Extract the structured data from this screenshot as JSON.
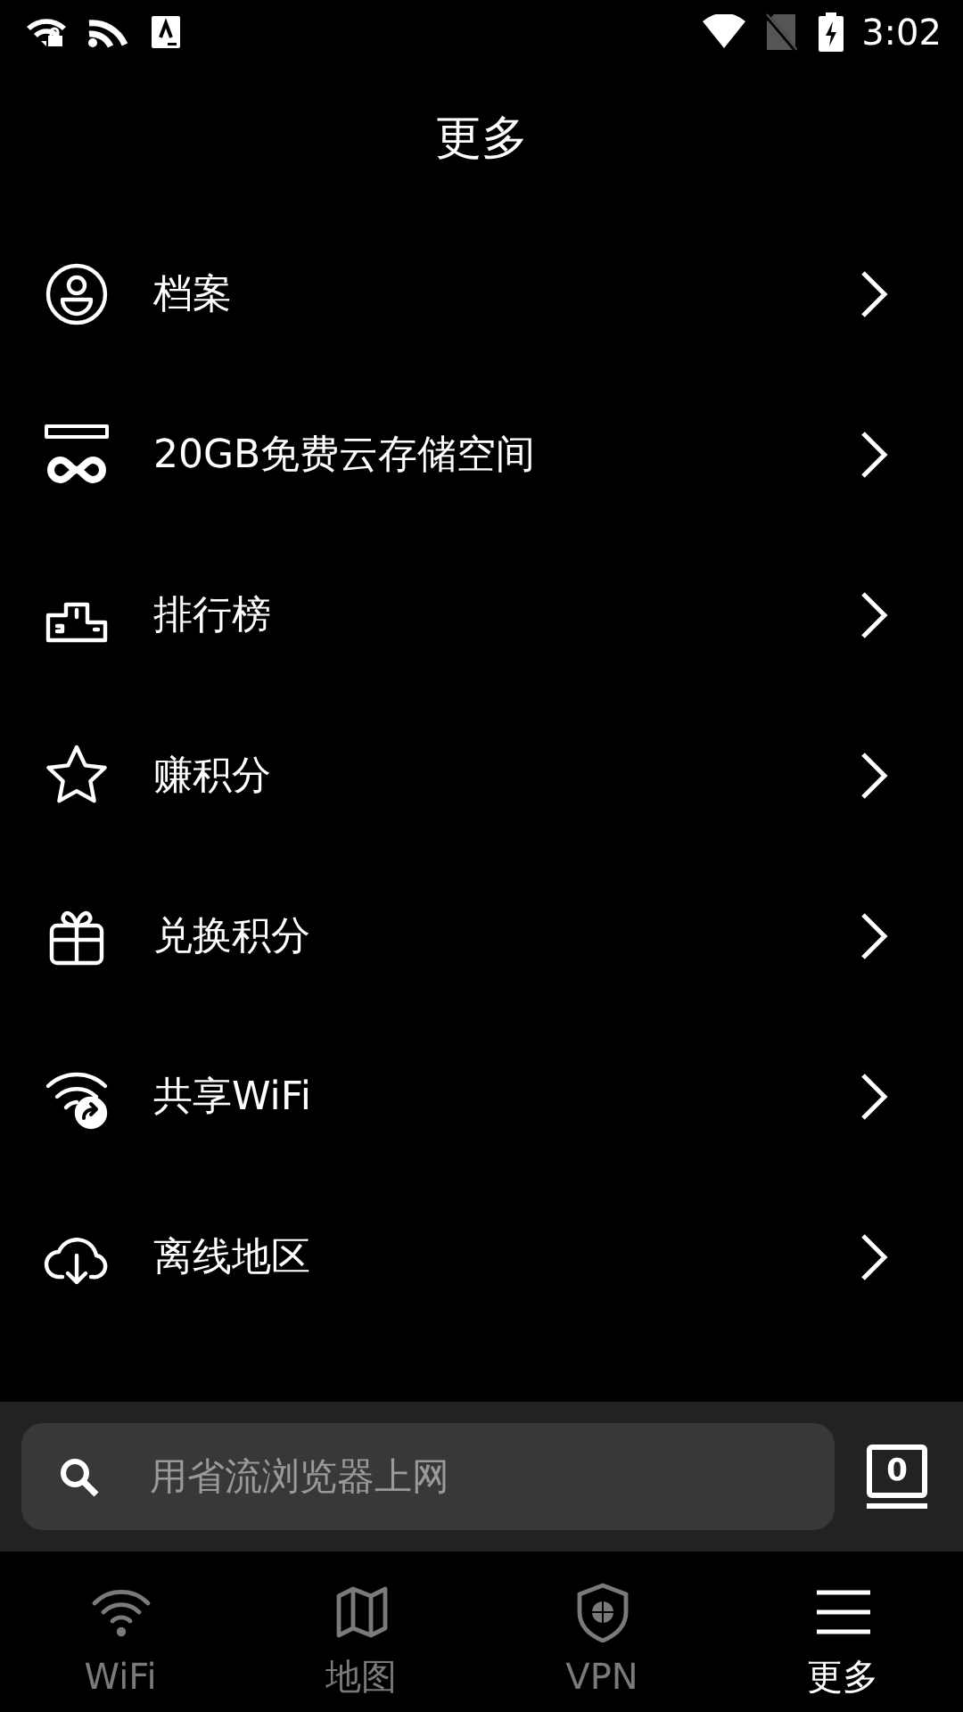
{
  "status_bar": {
    "time": "3:02"
  },
  "header": {
    "title": "更多"
  },
  "menu": [
    {
      "kind": "profile",
      "label": "档案"
    },
    {
      "kind": "cloud",
      "label": "20GB免费云存储空间"
    },
    {
      "kind": "podium",
      "label": "排行榜"
    },
    {
      "kind": "star",
      "label": "赚积分"
    },
    {
      "kind": "gift",
      "label": "兑换积分"
    },
    {
      "kind": "share-wifi",
      "label": "共享WiFi"
    },
    {
      "kind": "download",
      "label": "离线地区"
    }
  ],
  "search": {
    "placeholder": "用省流浏览器上网",
    "tab_count": "0"
  },
  "bottom_nav": [
    {
      "kind": "wifi",
      "label": "WiFi",
      "selected": false
    },
    {
      "kind": "map",
      "label": "地图",
      "selected": false
    },
    {
      "kind": "vpn",
      "label": "VPN",
      "selected": false
    },
    {
      "kind": "more",
      "label": "更多",
      "selected": true
    }
  ]
}
